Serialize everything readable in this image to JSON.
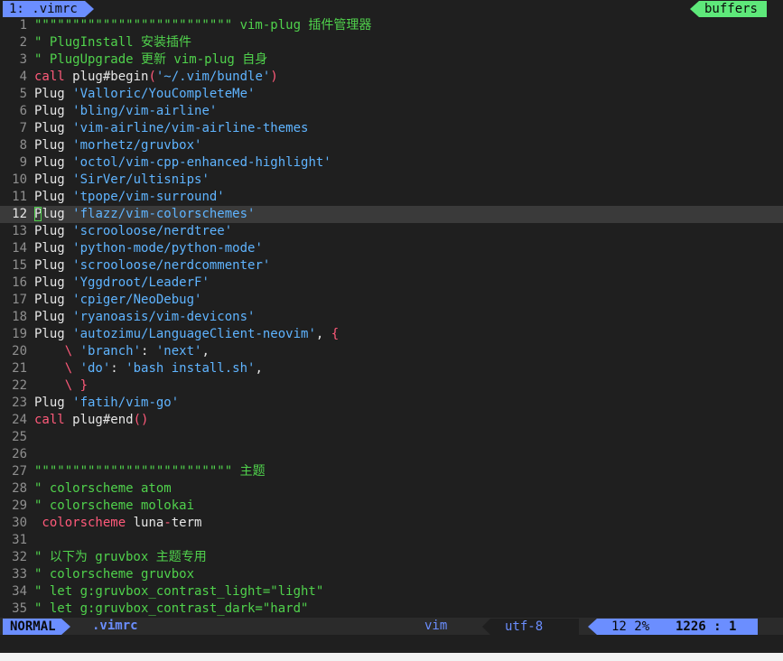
{
  "tabline": {
    "active_tab": "1: .vimrc",
    "buffers_label": "buffers"
  },
  "editor": {
    "cursor_line": 12,
    "lines": [
      {
        "n": "1",
        "tokens": [
          {
            "t": "\"\"\"\"\"\"\"\"\"\"\"\"\"\"\"\"\"\"\"\"\"\"\"\"\"\" vim-plug 插件管理器",
            "c": "comment"
          }
        ]
      },
      {
        "n": "2",
        "tokens": [
          {
            "t": "\" PlugInstall 安装插件",
            "c": "comment"
          }
        ]
      },
      {
        "n": "3",
        "tokens": [
          {
            "t": "\" PlugUpgrade 更新 vim-plug 自身",
            "c": "comment"
          }
        ]
      },
      {
        "n": "4",
        "tokens": [
          {
            "t": "call",
            "c": "kw"
          },
          {
            "t": " plug#begin",
            "c": "plain"
          },
          {
            "t": "(",
            "c": "kw"
          },
          {
            "t": "'~/.vim/bundle'",
            "c": "str"
          },
          {
            "t": ")",
            "c": "kw"
          }
        ]
      },
      {
        "n": "5",
        "tokens": [
          {
            "t": "Plug ",
            "c": "plain"
          },
          {
            "t": "'Valloric/YouCompleteMe'",
            "c": "str"
          }
        ]
      },
      {
        "n": "6",
        "tokens": [
          {
            "t": "Plug ",
            "c": "plain"
          },
          {
            "t": "'bling/vim-airline'",
            "c": "str"
          }
        ]
      },
      {
        "n": "7",
        "tokens": [
          {
            "t": "Plug ",
            "c": "plain"
          },
          {
            "t": "'vim-airline/vim-airline-themes",
            "c": "str"
          }
        ]
      },
      {
        "n": "8",
        "tokens": [
          {
            "t": "Plug ",
            "c": "plain"
          },
          {
            "t": "'morhetz/gruvbox'",
            "c": "str"
          }
        ]
      },
      {
        "n": "9",
        "tokens": [
          {
            "t": "Plug ",
            "c": "plain"
          },
          {
            "t": "'octol/vim-cpp-enhanced-highlight'",
            "c": "str"
          }
        ]
      },
      {
        "n": "10",
        "tokens": [
          {
            "t": "Plug ",
            "c": "plain"
          },
          {
            "t": "'SirVer/ultisnips'",
            "c": "str"
          }
        ]
      },
      {
        "n": "11",
        "tokens": [
          {
            "t": "Plug ",
            "c": "plain"
          },
          {
            "t": "'tpope/vim-surround'",
            "c": "str"
          }
        ]
      },
      {
        "n": "12",
        "tokens": [
          {
            "t": "P",
            "c": "plain cursor"
          },
          {
            "t": "lug ",
            "c": "plain"
          },
          {
            "t": "'flazz/vim-colorschemes'",
            "c": "str"
          }
        ]
      },
      {
        "n": "13",
        "tokens": [
          {
            "t": "Plug ",
            "c": "plain"
          },
          {
            "t": "'scrooloose/nerdtree'",
            "c": "str"
          }
        ]
      },
      {
        "n": "14",
        "tokens": [
          {
            "t": "Plug ",
            "c": "plain"
          },
          {
            "t": "'python-mode/python-mode'",
            "c": "str"
          }
        ]
      },
      {
        "n": "15",
        "tokens": [
          {
            "t": "Plug ",
            "c": "plain"
          },
          {
            "t": "'scrooloose/nerdcommenter'",
            "c": "str"
          }
        ]
      },
      {
        "n": "16",
        "tokens": [
          {
            "t": "Plug ",
            "c": "plain"
          },
          {
            "t": "'Yggdroot/LeaderF'",
            "c": "str"
          }
        ]
      },
      {
        "n": "17",
        "tokens": [
          {
            "t": "Plug ",
            "c": "plain"
          },
          {
            "t": "'cpiger/NeoDebug'",
            "c": "str"
          }
        ]
      },
      {
        "n": "18",
        "tokens": [
          {
            "t": "Plug ",
            "c": "plain"
          },
          {
            "t": "'ryanoasis/vim-devicons'",
            "c": "str"
          }
        ]
      },
      {
        "n": "19",
        "tokens": [
          {
            "t": "Plug ",
            "c": "plain"
          },
          {
            "t": "'autozimu/LanguageClient-neovim'",
            "c": "str"
          },
          {
            "t": ", ",
            "c": "plain"
          },
          {
            "t": "{",
            "c": "kw"
          }
        ]
      },
      {
        "n": "20",
        "tokens": [
          {
            "t": "    \\ ",
            "c": "kw"
          },
          {
            "t": "'branch'",
            "c": "str"
          },
          {
            "t": ": ",
            "c": "plain"
          },
          {
            "t": "'next'",
            "c": "str"
          },
          {
            "t": ",",
            "c": "plain"
          }
        ]
      },
      {
        "n": "21",
        "tokens": [
          {
            "t": "    \\ ",
            "c": "kw"
          },
          {
            "t": "'do'",
            "c": "str"
          },
          {
            "t": ": ",
            "c": "plain"
          },
          {
            "t": "'bash install.sh'",
            "c": "str"
          },
          {
            "t": ",",
            "c": "plain"
          }
        ]
      },
      {
        "n": "22",
        "tokens": [
          {
            "t": "    \\ }",
            "c": "kw"
          }
        ]
      },
      {
        "n": "23",
        "tokens": [
          {
            "t": "Plug ",
            "c": "plain"
          },
          {
            "t": "'fatih/vim-go'",
            "c": "str"
          }
        ]
      },
      {
        "n": "24",
        "tokens": [
          {
            "t": "call",
            "c": "kw"
          },
          {
            "t": " plug#end",
            "c": "plain"
          },
          {
            "t": "()",
            "c": "kw"
          }
        ]
      },
      {
        "n": "25",
        "tokens": []
      },
      {
        "n": "26",
        "tokens": []
      },
      {
        "n": "27",
        "tokens": [
          {
            "t": "\"\"\"\"\"\"\"\"\"\"\"\"\"\"\"\"\"\"\"\"\"\"\"\"\"\" 主题",
            "c": "comment"
          }
        ]
      },
      {
        "n": "28",
        "tokens": [
          {
            "t": "\" colorscheme atom",
            "c": "comment"
          }
        ]
      },
      {
        "n": "29",
        "tokens": [
          {
            "t": "\" colorscheme molokai",
            "c": "comment"
          }
        ]
      },
      {
        "n": "30",
        "tokens": [
          {
            "t": " colorscheme",
            "c": "kw"
          },
          {
            "t": " luna",
            "c": "plain"
          },
          {
            "t": "-",
            "c": "kw"
          },
          {
            "t": "term",
            "c": "plain"
          }
        ]
      },
      {
        "n": "31",
        "tokens": []
      },
      {
        "n": "32",
        "tokens": [
          {
            "t": "\" 以下为 gruvbox 主题专用",
            "c": "comment"
          }
        ]
      },
      {
        "n": "33",
        "tokens": [
          {
            "t": "\" colorscheme gruvbox",
            "c": "comment"
          }
        ]
      },
      {
        "n": "34",
        "tokens": [
          {
            "t": "\" let g:gruvbox_contrast_light=\"light\"",
            "c": "comment"
          }
        ]
      },
      {
        "n": "35",
        "tokens": [
          {
            "t": "\" let g:gruvbox_contrast_dark=\"hard\"",
            "c": "comment"
          }
        ]
      }
    ]
  },
  "statusline": {
    "mode": "NORMAL",
    "filename": ".vimrc",
    "filetype": "vim",
    "encoding": "utf-8",
    "percent": "12 2%",
    "linecol": "1226 :  1"
  },
  "colors": {
    "background": "#1f1f1f",
    "comment": "#50d24c",
    "keyword": "#ff5a7a",
    "string": "#5fb4ff",
    "accent_blue": "#6b8eff",
    "accent_green": "#5ee87a"
  }
}
